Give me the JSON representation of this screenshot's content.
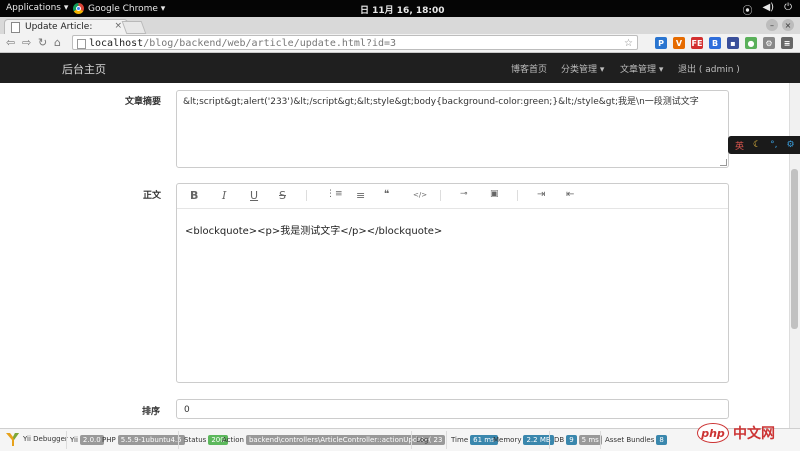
{
  "system_bar": {
    "applications": "Applications ▾",
    "active_app": "Google Chrome ▾",
    "clock": "日 11月 16, 18:00",
    "icons": [
      "network-icon",
      "volume-icon",
      "power-icon"
    ]
  },
  "browser": {
    "tab_title": "Update Article: ",
    "tab_close": "×",
    "url_host": "localhost",
    "url_path": "/blog/backend/web/article/update.html?id=3",
    "extensions": [
      {
        "name": "paypal-ext-icon",
        "color": "#2a75d0",
        "glyph": "P"
      },
      {
        "name": "vk-ext-icon",
        "color": "#e66b00",
        "glyph": "V"
      },
      {
        "name": "fe-ext-icon",
        "color": "#d32f2f",
        "glyph": "FE"
      },
      {
        "name": "baidu-ext-icon",
        "color": "#2f6edb",
        "glyph": "B"
      },
      {
        "name": "square-ext-icon",
        "color": "#3a4f9a",
        "glyph": "▪"
      },
      {
        "name": "circle-ext-icon",
        "color": "#5ab05a",
        "glyph": "●"
      },
      {
        "name": "gear-ext-icon",
        "color": "#888888",
        "glyph": "⚙"
      },
      {
        "name": "menu-icon",
        "color": "#666666",
        "glyph": "≡"
      }
    ]
  },
  "navbar": {
    "brand": "后台主页",
    "links": [
      {
        "label": "博客首页",
        "caret": ""
      },
      {
        "label": "分类管理",
        "caret": "▾"
      },
      {
        "label": "文章管理",
        "caret": "▾"
      },
      {
        "label": "退出 ( admin )",
        "caret": ""
      }
    ]
  },
  "form": {
    "summary_label": "文章摘要",
    "summary_value": "&lt;script&gt;alert('233')&lt;/script&gt;&lt;style&gt;body{background-color:green;}&lt;/style&gt;我是\\n一段测试文字",
    "content_label": "正文",
    "editor_tools": [
      {
        "name": "bold-icon",
        "glyph": "B"
      },
      {
        "name": "italic-icon",
        "glyph": "I"
      },
      {
        "name": "underline-icon",
        "glyph": "U"
      },
      {
        "name": "strikethrough-icon",
        "glyph": "S"
      },
      {
        "name": "ordered-list-icon",
        "glyph": "⋮≡"
      },
      {
        "name": "unordered-list-icon",
        "glyph": "≡"
      },
      {
        "name": "blockquote-icon",
        "glyph": "❝❝"
      },
      {
        "name": "code-icon",
        "glyph": "</>"
      },
      {
        "name": "link-icon",
        "glyph": "🔗"
      },
      {
        "name": "image-icon",
        "glyph": "▭"
      },
      {
        "name": "indent-icon",
        "glyph": "⇥"
      },
      {
        "name": "outdent-icon",
        "glyph": "⇤"
      }
    ],
    "content_value": "<blockquote><p>我是测试文字</p></blockquote>",
    "order_label": "排序",
    "order_value": "0"
  },
  "ime": {
    "lang": "英",
    "icons": [
      "moon-icon",
      "punctuation-icon",
      "settings-icon"
    ]
  },
  "debugbar": {
    "logo_label": "Yii Debugger",
    "yii_label": "Yii",
    "yii_version": "2.0.0",
    "php_label": "PHP",
    "php_version": "5.5.9-1ubuntu4.5",
    "status_label": "Status",
    "status_value": "200",
    "action_label": "Action",
    "action_value": "backend\\controllers\\ArticleController::actionUpdate()",
    "log_label": "Log",
    "log_value": "23",
    "time_label": "Time",
    "time_value": "61 ms",
    "memory_label": "Memory",
    "memory_value": "2.2 MB",
    "db_label": "DB",
    "db_count": "9",
    "db_time": "5 ms",
    "assets_label": "Asset Bundles",
    "assets_value": "8"
  },
  "watermark": {
    "php": "php",
    "site": "中文网"
  }
}
